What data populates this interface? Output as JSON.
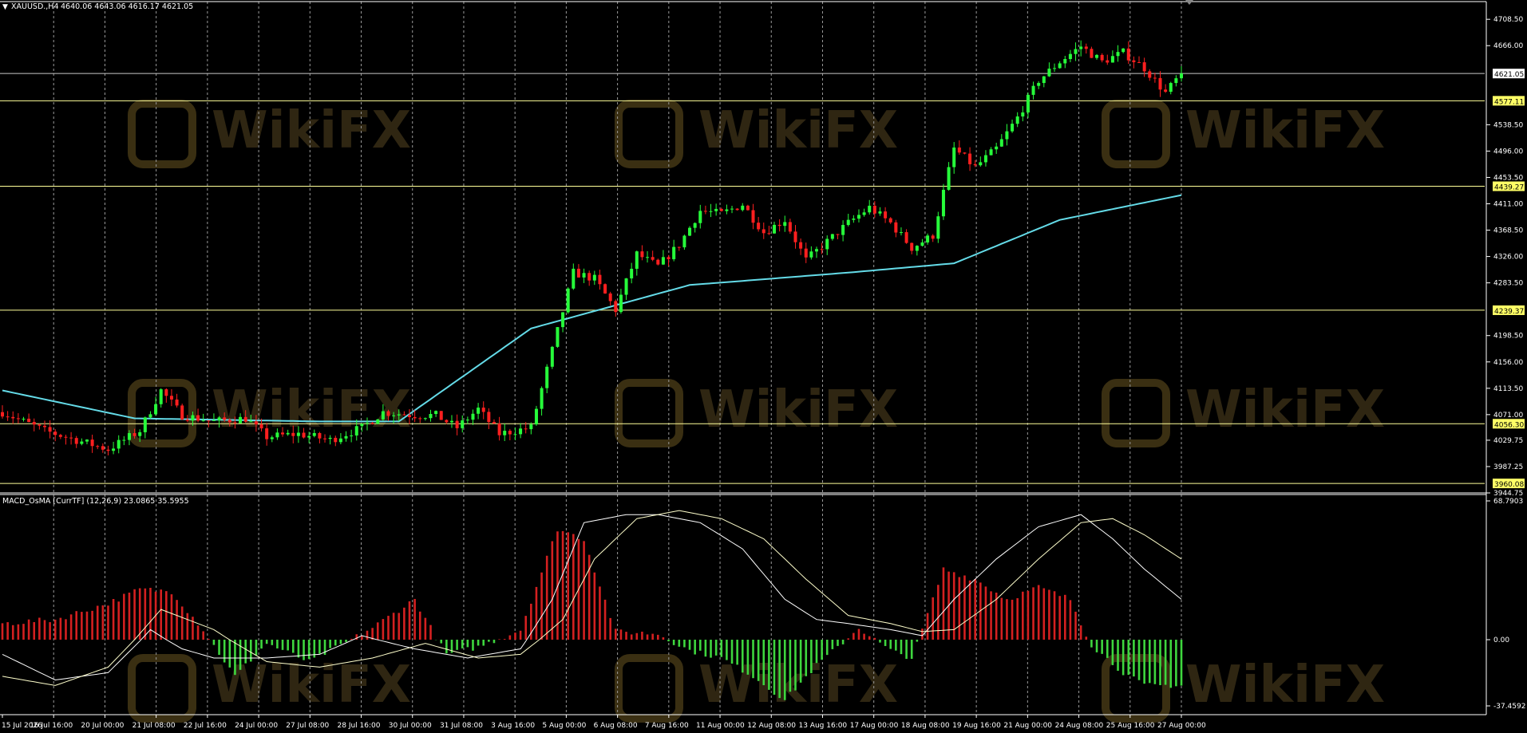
{
  "header": {
    "symbol_label": "XAUUSD.,H4",
    "ohlc_text": "4640.06 4643.06 4616.17 4621.05"
  },
  "indicator": {
    "label": "MACD_OsMA [CurrTF] (12,26,9) 23.0865 35.5955",
    "axis_top": "68.7903",
    "axis_zero": "0.00",
    "axis_bottom": "-37.4592"
  },
  "colors": {
    "background": "#000000",
    "bull": "#26ff3a",
    "bear": "#ff1f1f",
    "ma": "#64dbe8",
    "level": "#ffff99",
    "current": "#c8c8c8",
    "grid": "#9a9a9a",
    "osma_pos": "#d42020",
    "osma_neg": "#3ed63e",
    "macd": "#ffffff",
    "signal": "#ffffcc"
  },
  "watermark": "WikiFX",
  "chart_data": {
    "type": "candlestick",
    "price_axis": {
      "ylim": [
        3944.75,
        4708.75
      ],
      "ticks": [
        "4708.50",
        "4666.00",
        "4538.50",
        "4496.00",
        "4453.50",
        "4411.00",
        "4368.50",
        "4326.00",
        "4283.50",
        "4198.50",
        "4156.00",
        "4113.50",
        "4071.00",
        "4029.75",
        "3987.25",
        "3944.75"
      ]
    },
    "current_price": "4621.05",
    "levels": [
      "4577.11",
      "4439.27",
      "4239.37",
      "4056.30",
      "3960.08"
    ],
    "time_labels": [
      "15 Jul 2026",
      "16 Jul 16:00",
      "20 Jul 00:00",
      "21 Jul 08:00",
      "22 Jul 16:00",
      "24 Jul 00:00",
      "27 Jul 08:00",
      "28 Jul 16:00",
      "30 Jul 00:00",
      "31 Jul 08:00",
      "3 Aug 16:00",
      "5 Aug 00:00",
      "6 Aug 08:00",
      "7 Aug 16:00",
      "11 Aug 00:00",
      "12 Aug 08:00",
      "13 Aug 16:00",
      "17 Aug 00:00",
      "18 Aug 08:00",
      "19 Aug 16:00",
      "21 Aug 00:00",
      "24 Aug 08:00",
      "25 Aug 16:00",
      "27 Aug 00:00"
    ],
    "close_path": [
      [
        0,
        4075
      ],
      [
        8,
        4045
      ],
      [
        14,
        4030
      ],
      [
        20,
        4015
      ],
      [
        26,
        4045
      ],
      [
        30,
        4110
      ],
      [
        34,
        4070
      ],
      [
        40,
        4060
      ],
      [
        46,
        4065
      ],
      [
        50,
        4035
      ],
      [
        56,
        4040
      ],
      [
        62,
        4030
      ],
      [
        68,
        4050
      ],
      [
        72,
        4075
      ],
      [
        78,
        4070
      ],
      [
        82,
        4070
      ],
      [
        86,
        4050
      ],
      [
        90,
        4080
      ],
      [
        94,
        4040
      ],
      [
        100,
        4050
      ],
      [
        108,
        4300
      ],
      [
        112,
        4290
      ],
      [
        116,
        4240
      ],
      [
        120,
        4330
      ],
      [
        124,
        4310
      ],
      [
        128,
        4345
      ],
      [
        132,
        4400
      ],
      [
        136,
        4395
      ],
      [
        140,
        4410
      ],
      [
        144,
        4365
      ],
      [
        148,
        4385
      ],
      [
        152,
        4320
      ],
      [
        156,
        4350
      ],
      [
        160,
        4380
      ],
      [
        164,
        4405
      ],
      [
        168,
        4380
      ],
      [
        172,
        4340
      ],
      [
        176,
        4360
      ],
      [
        180,
        4500
      ],
      [
        184,
        4470
      ],
      [
        188,
        4500
      ],
      [
        192,
        4550
      ],
      [
        196,
        4610
      ],
      [
        200,
        4640
      ],
      [
        204,
        4665
      ],
      [
        208,
        4640
      ],
      [
        212,
        4655
      ],
      [
        216,
        4630
      ],
      [
        220,
        4590
      ],
      [
        223,
        4621
      ]
    ],
    "ma_points": [
      [
        0,
        4110
      ],
      [
        25,
        4065
      ],
      [
        60,
        4060
      ],
      [
        75,
        4060
      ],
      [
        100,
        4210
      ],
      [
        130,
        4280
      ],
      [
        160,
        4300
      ],
      [
        180,
        4315
      ],
      [
        200,
        4385
      ],
      [
        223,
        4425
      ]
    ],
    "osma_range": [
      -37.4592,
      68.7903
    ],
    "osma_hist": [
      [
        0,
        8
      ],
      [
        10,
        10
      ],
      [
        20,
        18
      ],
      [
        26,
        25
      ],
      [
        32,
        24
      ],
      [
        38,
        5
      ],
      [
        44,
        -20
      ],
      [
        50,
        -2
      ],
      [
        58,
        -12
      ],
      [
        70,
        6
      ],
      [
        78,
        20
      ],
      [
        84,
        -8
      ],
      [
        90,
        -4
      ],
      [
        98,
        5
      ],
      [
        105,
        55
      ],
      [
        110,
        50
      ],
      [
        116,
        4
      ],
      [
        124,
        3
      ],
      [
        130,
        -6
      ],
      [
        136,
        -10
      ],
      [
        142,
        -20
      ],
      [
        148,
        -33
      ],
      [
        154,
        -14
      ],
      [
        162,
        6
      ],
      [
        168,
        -6
      ],
      [
        172,
        -10
      ],
      [
        178,
        35
      ],
      [
        184,
        30
      ],
      [
        190,
        20
      ],
      [
        196,
        26
      ],
      [
        202,
        20
      ],
      [
        206,
        -3
      ],
      [
        212,
        -18
      ],
      [
        216,
        -25
      ],
      [
        222,
        -25
      ]
    ],
    "macd_points": [
      [
        0,
        -8
      ],
      [
        10,
        -22
      ],
      [
        20,
        -18
      ],
      [
        28,
        5
      ],
      [
        34,
        -5
      ],
      [
        40,
        -10
      ],
      [
        50,
        -10
      ],
      [
        60,
        -8
      ],
      [
        68,
        2
      ],
      [
        78,
        -5
      ],
      [
        88,
        -10
      ],
      [
        98,
        -5
      ],
      [
        104,
        20
      ],
      [
        110,
        58
      ],
      [
        118,
        62
      ],
      [
        124,
        62
      ],
      [
        132,
        58
      ],
      [
        140,
        45
      ],
      [
        148,
        20
      ],
      [
        154,
        10
      ],
      [
        160,
        8
      ],
      [
        168,
        5
      ],
      [
        174,
        2
      ],
      [
        180,
        20
      ],
      [
        188,
        40
      ],
      [
        196,
        56
      ],
      [
        204,
        62
      ],
      [
        210,
        50
      ],
      [
        216,
        35
      ],
      [
        223,
        20
      ]
    ],
    "signal_points": [
      [
        0,
        -20
      ],
      [
        10,
        -25
      ],
      [
        20,
        -15
      ],
      [
        30,
        15
      ],
      [
        40,
        5
      ],
      [
        50,
        -12
      ],
      [
        60,
        -15
      ],
      [
        70,
        -10
      ],
      [
        80,
        -2
      ],
      [
        90,
        -10
      ],
      [
        98,
        -8
      ],
      [
        106,
        10
      ],
      [
        112,
        40
      ],
      [
        120,
        60
      ],
      [
        128,
        64
      ],
      [
        136,
        60
      ],
      [
        144,
        50
      ],
      [
        152,
        30
      ],
      [
        160,
        12
      ],
      [
        168,
        8
      ],
      [
        174,
        4
      ],
      [
        180,
        5
      ],
      [
        188,
        20
      ],
      [
        196,
        40
      ],
      [
        204,
        58
      ],
      [
        210,
        60
      ],
      [
        216,
        52
      ],
      [
        223,
        40
      ]
    ]
  }
}
